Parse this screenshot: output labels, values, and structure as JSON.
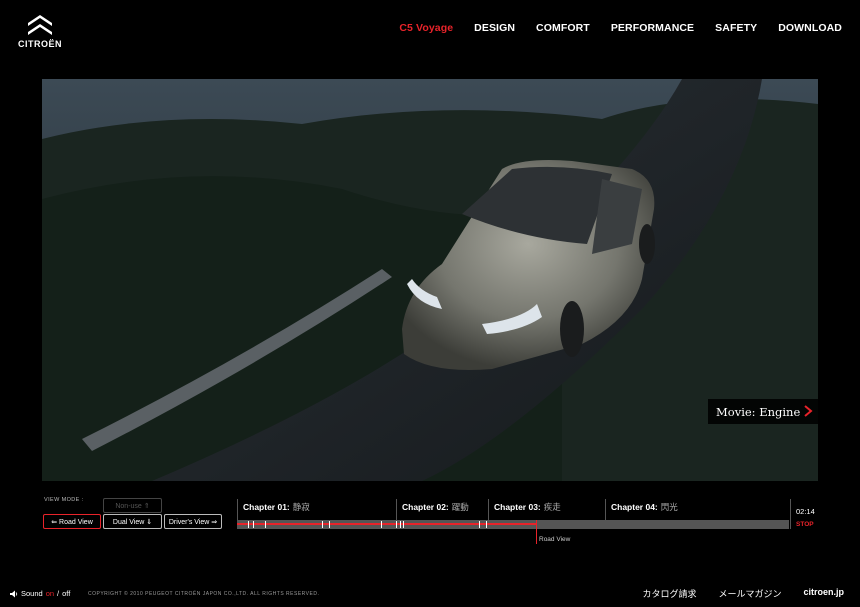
{
  "brand": {
    "logo_text": "CITROËN"
  },
  "nav": {
    "items": [
      {
        "label": "C5 Voyage",
        "active": true
      },
      {
        "label": "DESIGN"
      },
      {
        "label": "COMFORT"
      },
      {
        "label": "PERFORMANCE"
      },
      {
        "label": "SAFETY"
      },
      {
        "label": "DOWNLOAD"
      }
    ]
  },
  "video": {
    "movie_label": "Movie: Engine"
  },
  "view_mode": {
    "label": "VIEW MODE :",
    "non_use": "Non-use ⇑",
    "road_view": "⇐ Road View",
    "dual_view": "Dual View ⇓",
    "drivers_view": "Driver's View ⇒"
  },
  "timeline": {
    "chapters": [
      {
        "label": "Chapter 01:",
        "jp": "静寂"
      },
      {
        "label": "Chapter 02:",
        "jp": "躍動"
      },
      {
        "label": "Chapter 03:",
        "jp": "疾走"
      },
      {
        "label": "Chapter 04:",
        "jp": "閃光"
      }
    ],
    "time": "02:14",
    "stop_label": "STOP",
    "playhead_label": "Road View"
  },
  "footer": {
    "sound_label": "Sound",
    "sound_on": "on",
    "sound_sep": "/",
    "sound_off": "off",
    "copyright": "COPYRIGHT © 2010 PEUGEOT CITROËN JAPON CO.,LTD. ALL RIGHTS RESERVED.",
    "links": [
      "カタログ請求",
      "メールマガジン",
      "citroen.jp"
    ]
  },
  "colors": {
    "accent": "#e8232a",
    "background": "#000000"
  }
}
